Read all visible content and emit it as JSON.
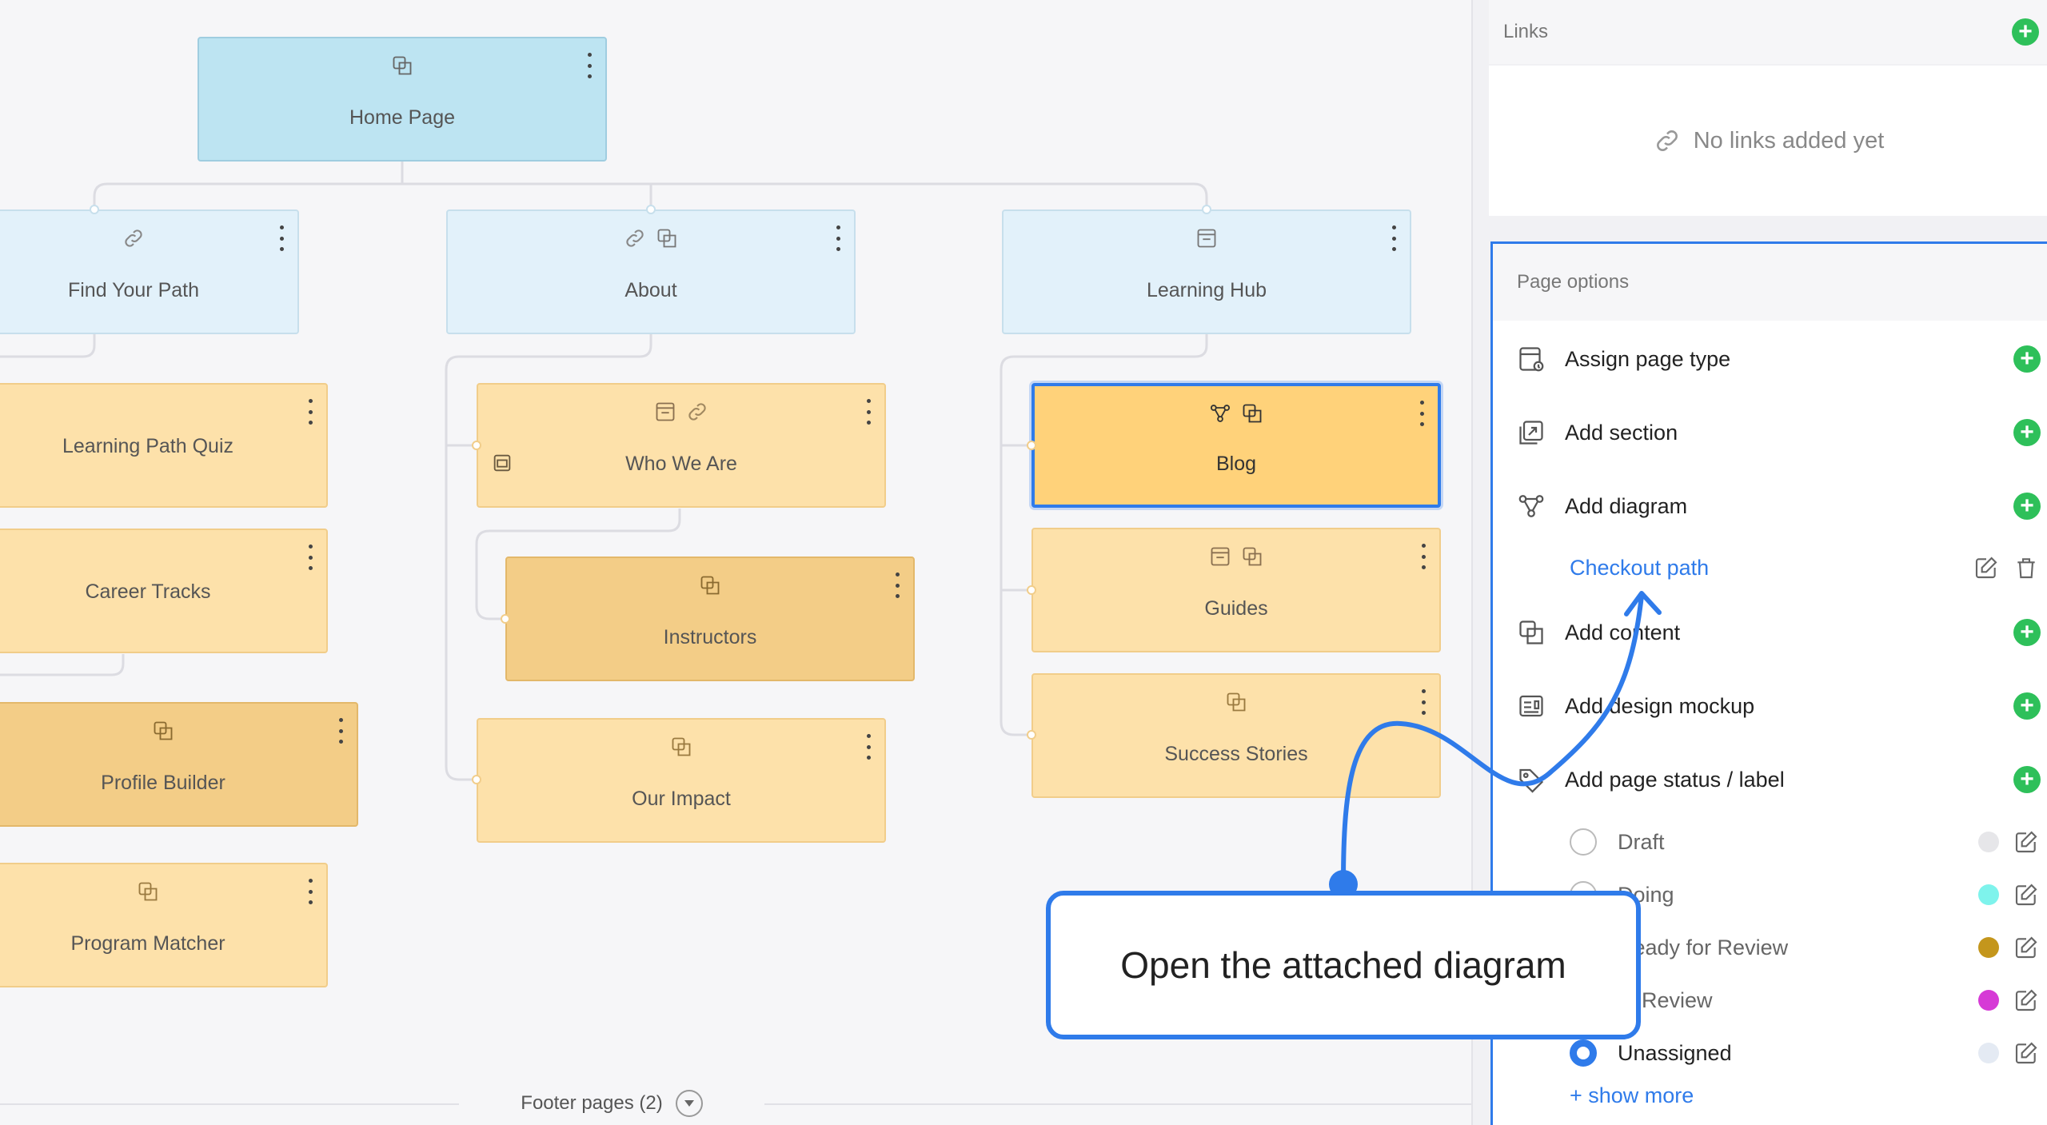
{
  "canvas": {
    "nodes": {
      "home": {
        "title": "Home Page"
      },
      "find_your_path": {
        "title": "Find Your Path"
      },
      "about": {
        "title": "About"
      },
      "learning_hub": {
        "title": "Learning Hub"
      },
      "learning_path_quiz": {
        "title": "Learning Path Quiz"
      },
      "career_tracks": {
        "title": "Career Tracks"
      },
      "profile_builder": {
        "title": "Profile Builder"
      },
      "program_matcher": {
        "title": "Program Matcher"
      },
      "who_we_are": {
        "title": "Who We Are"
      },
      "instructors": {
        "title": "Instructors"
      },
      "our_impact": {
        "title": "Our Impact"
      },
      "blog": {
        "title": "Blog"
      },
      "guides": {
        "title": "Guides"
      },
      "success_stories": {
        "title": "Success Stories"
      }
    },
    "footer": {
      "label": "Footer pages (2)"
    }
  },
  "panel": {
    "links": {
      "label": "Links",
      "empty_text": "No links added yet"
    },
    "page_options": {
      "label": "Page options",
      "assign_page_type": "Assign page type",
      "add_section": "Add section",
      "add_diagram": "Add diagram",
      "diagram_item": "Checkout path",
      "add_content": "Add content",
      "add_design_mockup": "Add design mockup",
      "add_page_status": "Add page status / label",
      "statuses": [
        {
          "label": "Draft",
          "color": "#e6e6e9",
          "selected": false
        },
        {
          "label": "Doing",
          "color": "#7ef3ec",
          "selected": false
        },
        {
          "label": "Ready for Review",
          "color": "#c4961c",
          "selected": false
        },
        {
          "label": "In Review",
          "color": "#d63ad6",
          "selected": false
        },
        {
          "label": "Unassigned",
          "color": "#e4eaf3",
          "selected": true
        }
      ],
      "show_more": "+ show more"
    }
  },
  "callout": {
    "text": "Open the attached diagram"
  },
  "colors": {
    "accent": "#2f7bea",
    "add_green": "#2ec05a"
  }
}
